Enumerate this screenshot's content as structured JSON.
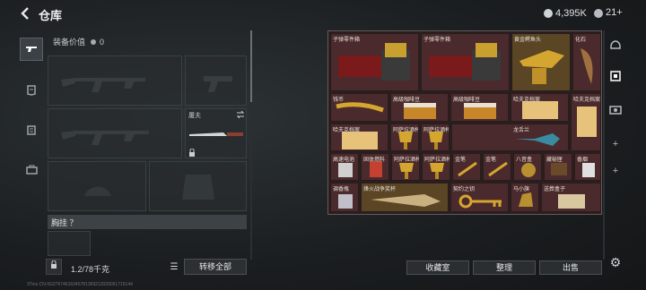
{
  "header": {
    "title": "仓库",
    "currency": "4,395K",
    "premium": "21+"
  },
  "equipment": {
    "value_label": "装备价值",
    "value": "0",
    "knife_label": "屠夫",
    "chest_label": "胸挂 ？",
    "weight": "1.2/78千克",
    "transfer_all": "转移全部"
  },
  "storage": {
    "items": [
      {
        "name": "子弹零件箱"
      },
      {
        "name": "子弹零件箱"
      },
      {
        "name": "黄金鳄鱼头"
      },
      {
        "name": "化石"
      },
      {
        "name": "钱币"
      },
      {
        "name": "高级咖啡豆"
      },
      {
        "name": "高级咖啡豆"
      },
      {
        "name": "哈夫克档案"
      },
      {
        "name": "哈夫克档案"
      },
      {
        "name": "哈夫克档案"
      },
      {
        "name": "阿萨拉酒杯"
      },
      {
        "name": "阿萨拉酒杯"
      },
      {
        "name": "龙舌兰"
      },
      {
        "name": "高速电池"
      },
      {
        "name": "固体燃料"
      },
      {
        "name": "阿萨拉酒杯"
      },
      {
        "name": "阿萨拉酒杯"
      },
      {
        "name": "金笔"
      },
      {
        "name": "金笔"
      },
      {
        "name": "八音盒"
      },
      {
        "name": "藏秘匣"
      },
      {
        "name": "香烟"
      },
      {
        "name": "调香瓶"
      },
      {
        "name": "烽火战争奖杯"
      },
      {
        "name": "契约之钥"
      },
      {
        "name": "马小旗"
      },
      {
        "name": "送葬盒子"
      }
    ]
  },
  "buttons": {
    "collection": "收藏室",
    "organize": "整理",
    "sell": "出售"
  },
  "status_text": "37ms  CN 0G27674616345781369212026051715144",
  "colors": {
    "storage_bg": "#2a1e1e",
    "cell_red": "#4a2a2c",
    "cell_gold": "#5a4525"
  }
}
